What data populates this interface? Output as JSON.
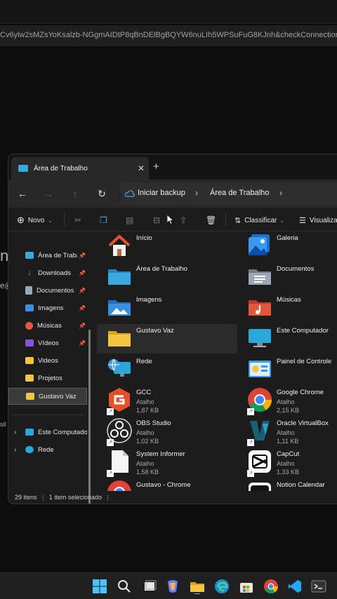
{
  "background": {
    "url": "Cv6ylw2sMZsYoKsalzb-NGgmAIDtP8qBnDElBgBQYW6nuLIh5WPSuFuG8KJnh&checkConnection=yo",
    "fragments": [
      "n",
      "e@",
      "sil",
      "s"
    ]
  },
  "window": {
    "tab_title": "Área de Trabalho",
    "address": {
      "segment1": "Iniciar backup",
      "segment2": "Área de Trabalho"
    }
  },
  "toolbar": {
    "new_label": "Novo",
    "sort_label": "Classificar",
    "view_label": "Visualizar"
  },
  "sidebar": {
    "items": [
      {
        "label": "Área de Trabalho",
        "icon": "desktop-folder-icon",
        "color": "#39a9e0",
        "pinned": true
      },
      {
        "label": "Downloads",
        "icon": "download-icon",
        "color": "#3ec76e",
        "pinned": true
      },
      {
        "label": "Documentos",
        "icon": "document-icon",
        "color": "#9aa7b5",
        "pinned": true
      },
      {
        "label": "Imagens",
        "icon": "image-icon",
        "color": "#3c8fe0",
        "pinned": true
      },
      {
        "label": "Músicas",
        "icon": "music-icon",
        "color": "#e0573d",
        "pinned": true
      },
      {
        "label": "Vídeos",
        "icon": "video-icon",
        "color": "#8a54d9",
        "pinned": true
      },
      {
        "label": "Videos",
        "icon": "folder-icon",
        "color": "#f4c542",
        "pinned": false
      },
      {
        "label": "Projetos",
        "icon": "folder-icon",
        "color": "#f4c542",
        "pinned": false
      },
      {
        "label": "Gustavo Vaz",
        "icon": "folder-icon",
        "color": "#f4c542",
        "pinned": false,
        "selected": true
      }
    ],
    "tree": [
      {
        "label": "Este Computador",
        "icon": "computer-icon"
      },
      {
        "label": "Rede",
        "icon": "network-icon"
      }
    ]
  },
  "content": {
    "items": [
      {
        "name": "Início",
        "icon": "home-icon"
      },
      {
        "name": "Galeria",
        "icon": "gallery-icon"
      },
      {
        "name": "Área de Trabalho",
        "icon": "desktop-folder-icon"
      },
      {
        "name": "Documentos",
        "icon": "documents-folder-icon"
      },
      {
        "name": "Imagens",
        "icon": "images-folder-icon"
      },
      {
        "name": "Músicas",
        "icon": "music-folder-icon"
      },
      {
        "name": "Gustavo Vaz",
        "icon": "folder-icon",
        "selected": true
      },
      {
        "name": "Este Computador",
        "icon": "computer-icon"
      },
      {
        "name": "Rede",
        "icon": "network-icon"
      },
      {
        "name": "Painel de Controle",
        "icon": "control-panel-icon"
      },
      {
        "name": "GCC",
        "type": "Atalho",
        "size": "1,87 KB",
        "icon": "gcc-icon"
      },
      {
        "name": "Google Chrome",
        "type": "Atalho",
        "size": "2,15 KB",
        "icon": "chrome-icon"
      },
      {
        "name": "OBS Studio",
        "type": "Atalho",
        "size": "1,02 KB",
        "icon": "obs-icon"
      },
      {
        "name": "Oracle VirtualBox",
        "type": "Atalho",
        "size": "1,11 KB",
        "icon": "virtualbox-icon"
      },
      {
        "name": "System Informer",
        "type": "Atalho",
        "size": "1,58 KB",
        "icon": "file-icon"
      },
      {
        "name": "CapCut",
        "type": "Atalho",
        "size": "1,33 KB",
        "icon": "capcut-icon"
      },
      {
        "name": "Gustavo - Chrome",
        "icon": "chrome-profile-icon"
      },
      {
        "name": "Notion Calendar",
        "icon": "notion-calendar-icon"
      }
    ]
  },
  "status": {
    "count": "29 itens",
    "selection": "1 item selecionado"
  },
  "taskbar": {
    "icons": [
      "windows-start-icon",
      "search-icon",
      "task-view-icon",
      "copilot-icon",
      "file-explorer-icon",
      "edge-icon",
      "store-icon",
      "chrome-icon",
      "vscode-icon",
      "terminal-icon"
    ]
  }
}
